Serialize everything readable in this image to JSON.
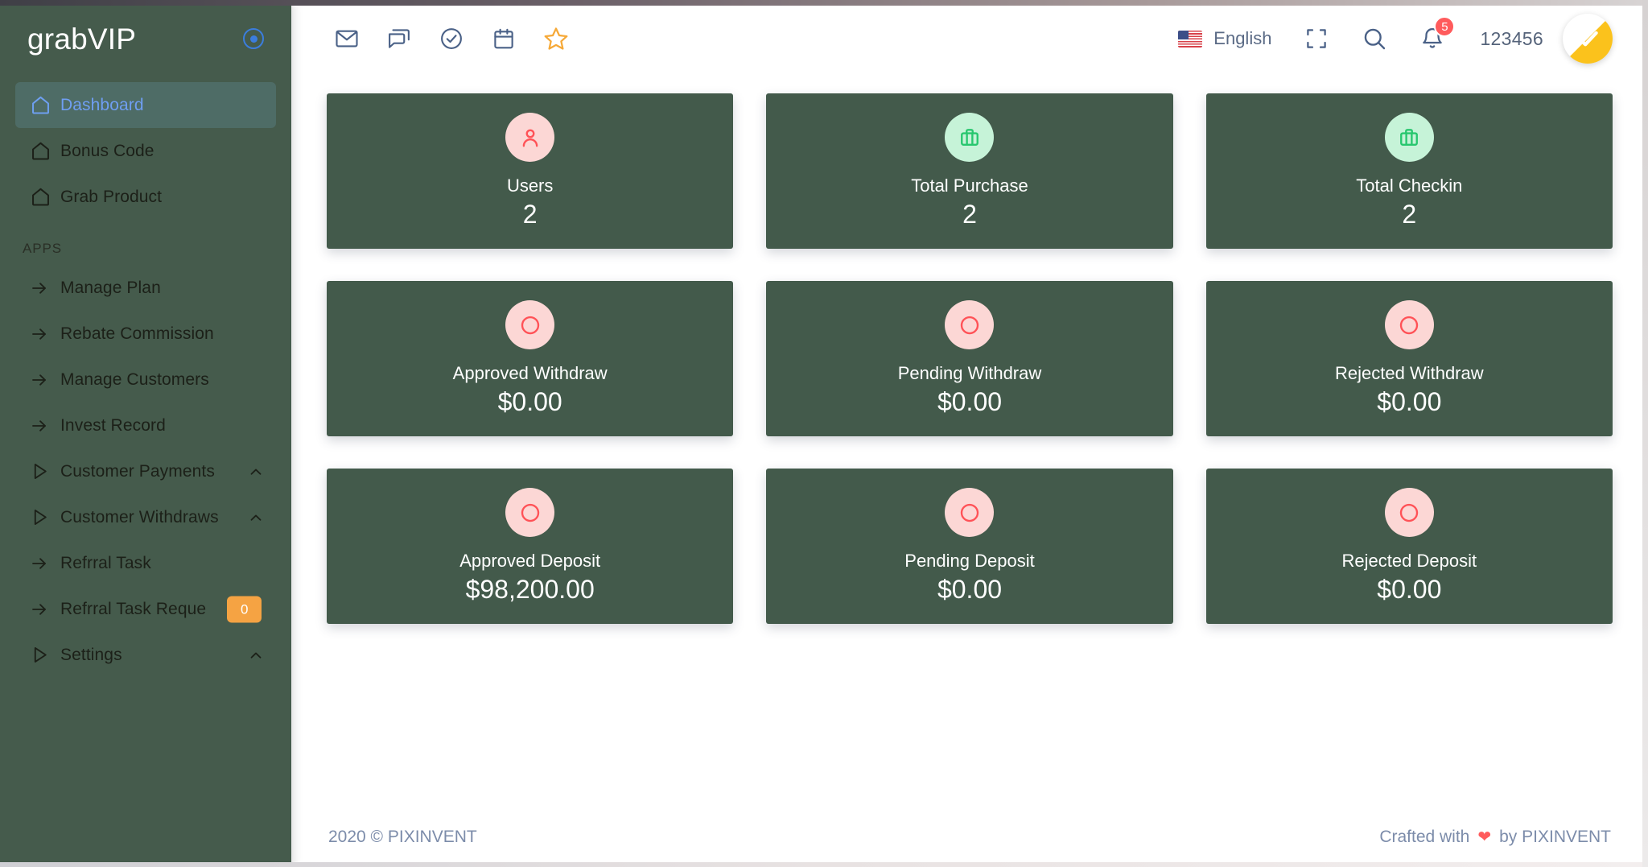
{
  "sidebar": {
    "brand": "grabVIP",
    "toggle_icon": "radio-circle-icon",
    "items": [
      {
        "label": "Dashboard",
        "icon": "home-icon",
        "active": true,
        "chevron": false,
        "badge": null
      },
      {
        "label": "Bonus Code",
        "icon": "home-icon",
        "active": false,
        "chevron": false,
        "badge": null
      },
      {
        "label": "Grab Product",
        "icon": "home-icon",
        "active": false,
        "chevron": false,
        "badge": null
      }
    ],
    "section_label": "APPS",
    "app_items": [
      {
        "label": "Manage Plan",
        "icon": "arrow-right-icon",
        "chevron": false,
        "badge": null
      },
      {
        "label": "Rebate Commission",
        "icon": "arrow-right-icon",
        "chevron": false,
        "badge": null
      },
      {
        "label": "Manage Customers",
        "icon": "arrow-right-icon",
        "chevron": false,
        "badge": null
      },
      {
        "label": "Invest Record",
        "icon": "arrow-right-icon",
        "chevron": false,
        "badge": null
      },
      {
        "label": "Customer Payments",
        "icon": "play-triangle-icon",
        "chevron": true,
        "badge": null
      },
      {
        "label": "Customer Withdraws",
        "icon": "play-triangle-icon",
        "chevron": true,
        "badge": null
      },
      {
        "label": "Refrral Task",
        "icon": "arrow-right-icon",
        "chevron": false,
        "badge": null
      },
      {
        "label": "Refrral Task Reque",
        "icon": "arrow-right-icon",
        "chevron": false,
        "badge": "0"
      },
      {
        "label": "Settings",
        "icon": "play-triangle-icon",
        "chevron": true,
        "badge": null
      }
    ]
  },
  "topbar": {
    "left_icons": [
      {
        "name": "mail-icon"
      },
      {
        "name": "chat-icon"
      },
      {
        "name": "check-circle-icon"
      },
      {
        "name": "calendar-icon"
      },
      {
        "name": "star-icon"
      }
    ],
    "language": "English",
    "flag_icon": "us-flag-icon",
    "fullscreen_icon": "fullscreen-icon",
    "search_icon": "search-icon",
    "bell_icon": "bell-icon",
    "notification_count": "5",
    "username": "123456",
    "avatar_icon": "check-avatar-icon"
  },
  "cards": [
    {
      "label": "Users",
      "value": "2",
      "icon": "user-icon",
      "icon_style": "pink"
    },
    {
      "label": "Total Purchase",
      "value": "2",
      "icon": "briefcase-icon",
      "icon_style": "green"
    },
    {
      "label": "Total Checkin",
      "value": "2",
      "icon": "briefcase-icon",
      "icon_style": "green"
    },
    {
      "label": "Approved Withdraw",
      "value": "$0.00",
      "icon": "circle-icon",
      "icon_style": "pink"
    },
    {
      "label": "Pending Withdraw",
      "value": "$0.00",
      "icon": "circle-icon",
      "icon_style": "pink"
    },
    {
      "label": "Rejected Withdraw",
      "value": "$0.00",
      "icon": "circle-icon",
      "icon_style": "pink"
    },
    {
      "label": "Approved Deposit",
      "value": "$98,200.00",
      "icon": "circle-icon",
      "icon_style": "pink"
    },
    {
      "label": "Pending Deposit",
      "value": "$0.00",
      "icon": "circle-icon",
      "icon_style": "pink"
    },
    {
      "label": "Rejected Deposit",
      "value": "$0.00",
      "icon": "circle-icon",
      "icon_style": "pink"
    }
  ],
  "footer": {
    "copyright": "2020 © PIXINVENT",
    "crafted_prefix": "Crafted with",
    "heart_icon": "heart-icon",
    "crafted_suffix": "by PIXINVENT"
  },
  "colors": {
    "sidebar_bg": "#455b4c",
    "card_bg": "#435a4b",
    "active_text": "#6f9ef2",
    "badge_orange": "#f5a343",
    "badge_red": "#ff5b5c",
    "avatar_yellow": "#fbc21c",
    "icon_pink_bg": "#fcd7d5",
    "icon_pink_fg": "#ff5257",
    "icon_green_bg": "#c6f3d8",
    "icon_green_fg": "#28c76f"
  }
}
